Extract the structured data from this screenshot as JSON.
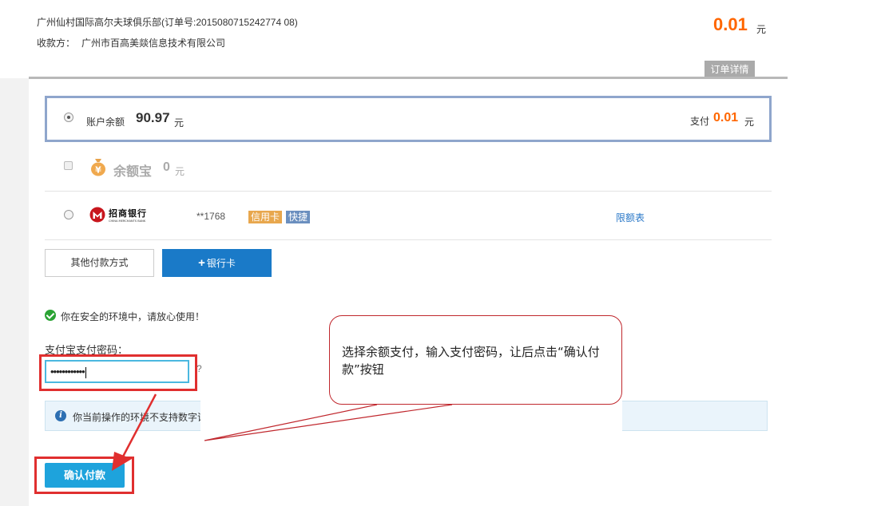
{
  "order": {
    "merchant_line": "广州仙村国际高尔夫球俱乐部(订单号:2015080715242774 08)",
    "payee_label": "收款方：",
    "payee_name": "广州市百高美燚信息技术有限公司",
    "amount": "0.01",
    "amount_unit": "元",
    "detail_tab": "订单详情"
  },
  "options": {
    "balance": {
      "label": "账户余额",
      "value": "90.97",
      "unit": "元",
      "pay_label": "支付",
      "pay_value": "0.01",
      "pay_unit": "元",
      "selected": true
    },
    "yuebao": {
      "name": "余额宝",
      "value": "0",
      "unit": "元",
      "icon": "money-bag-icon"
    },
    "bank": {
      "logo_name": "招商银行",
      "logo_sub": "CHINA MERCHANTS BANK",
      "card": "**1768",
      "tag_credit": "信用卡",
      "tag_quick": "快捷",
      "limit_link": "限额表"
    }
  },
  "buttons": {
    "other_methods": "其他付款方式",
    "add_card": "银行卡",
    "add_card_icon": "+",
    "confirm": "确认付款"
  },
  "security": {
    "safe_text": "你在安全的环境中，请放心使用！",
    "pwd_label": "支付宝支付密码：",
    "pwd_value": "••••••••••••",
    "pwd_extra": "?",
    "notice_text": "你当前操作的环境不支持数字证"
  },
  "callout": {
    "text": "选择余额支付，输入支付密码，让后点击“确认付款”按钮"
  },
  "colors": {
    "accent_orange": "#ff6600",
    "highlight_red": "#e02f2f",
    "primary_blue": "#1a7ac8",
    "confirm_blue": "#1ea3dc"
  }
}
